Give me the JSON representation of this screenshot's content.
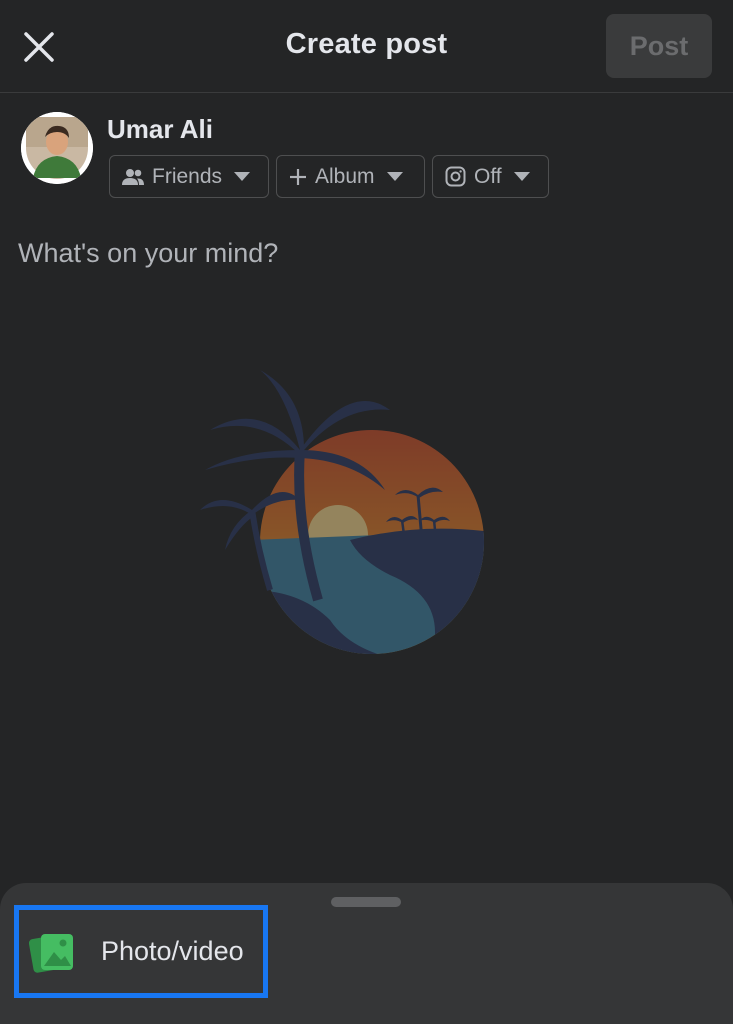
{
  "header": {
    "close_icon": "close-icon",
    "title": "Create post",
    "post_label": "Post"
  },
  "user": {
    "name": "Umar Ali",
    "avatar": "avatar"
  },
  "chips": {
    "audience": {
      "icon": "friends-icon",
      "label": "Friends"
    },
    "album": {
      "icon": "plus-icon",
      "label": "Album"
    },
    "instagram": {
      "icon": "instagram-icon",
      "label": "Off"
    }
  },
  "composer": {
    "placeholder": "What's on your mind?",
    "value": ""
  },
  "bottom_sheet": {
    "photo_video": {
      "icon": "photo-video-icon",
      "label": "Photo/video"
    }
  },
  "colors": {
    "background": "#242526",
    "sheet": "#353637",
    "highlight": "#1877f2",
    "photo_icon_green": "#45bd62"
  }
}
